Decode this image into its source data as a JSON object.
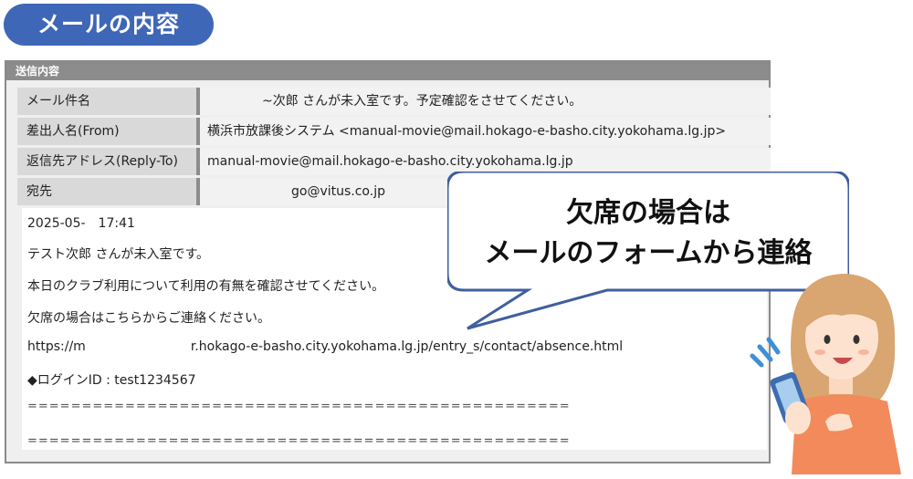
{
  "header": {
    "title": "メールの内容"
  },
  "panel": {
    "title": "送信内容",
    "rows": [
      {
        "label": "メール件名",
        "value": "~次郎 さんが未入室です。予定確認をさせてください。"
      },
      {
        "label": "差出人名(From)",
        "value": "横浜市放課後システム <manual-movie@mail.hokago-e-basho.city.yokohama.lg.jp>"
      },
      {
        "label": "返信先アドレス(Reply-To)",
        "value": "manual-movie@mail.hokago-e-basho.city.yokohama.lg.jp"
      },
      {
        "label": "宛先",
        "value": "go@vitus.co.jp"
      }
    ],
    "body": {
      "datetime": "2025-05-　17:41",
      "line1": "テスト次郎 さんが未入室です。",
      "line2": "本日のクラブ利用について利用の有無を確認させてください。",
      "line3": "欠席の場合はこちらからご連絡ください。",
      "url_start": "https://m",
      "url_end": "r.hokago-e-basho.city.yokohama.lg.jp/entry_s/contact/absence.html",
      "login": "◆ログインID : test1234567",
      "separator": "=================================================="
    }
  },
  "callout": {
    "line1": "欠席の場合は",
    "line2": "メールのフォームから連絡"
  },
  "colors": {
    "pill": "#3f67b8",
    "bubble_border": "#3f5f9e",
    "panel_header": "#8c8c8c"
  }
}
